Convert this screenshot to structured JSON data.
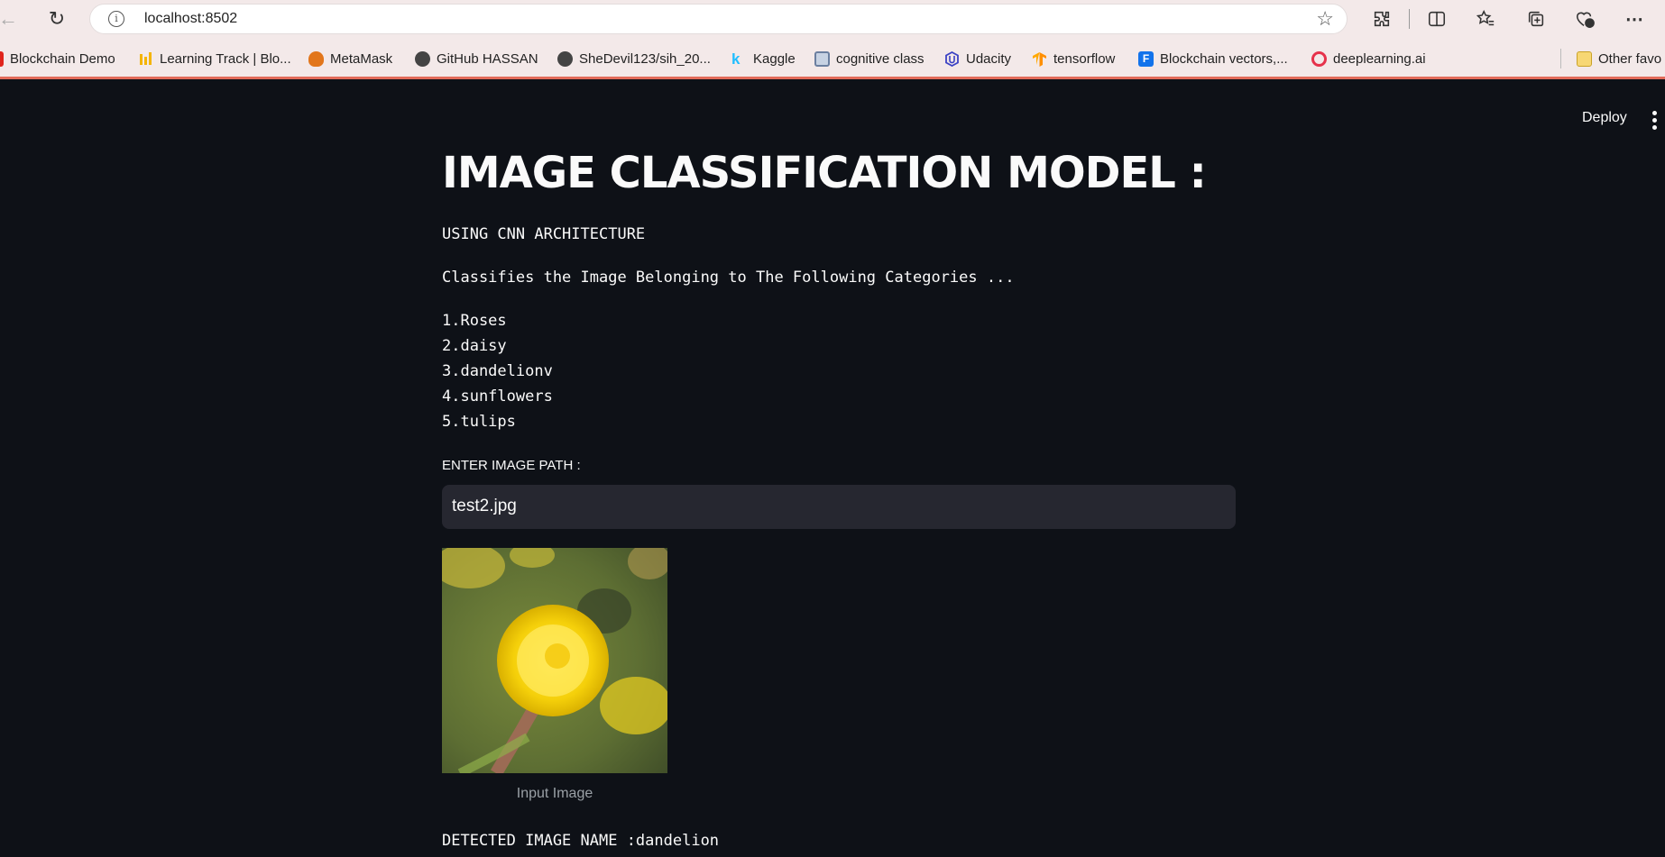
{
  "browser": {
    "url": "localhost:8502",
    "bookmarks": [
      {
        "label": "Blockchain Demo",
        "icon": "adobe-icon",
        "color": "#e0241c"
      },
      {
        "label": "Learning Track | Blo...",
        "icon": "bars-icon",
        "color": "#f4b400"
      },
      {
        "label": "MetaMask",
        "icon": "fox-icon",
        "color": "#e2761b"
      },
      {
        "label": "GitHub HASSAN",
        "icon": "github-icon",
        "color": "#444444"
      },
      {
        "label": "SheDevil123/sih_20...",
        "icon": "github-icon",
        "color": "#444444"
      },
      {
        "label": "Kaggle",
        "icon": "kaggle-icon",
        "color": "#20beff"
      },
      {
        "label": "cognitive class",
        "icon": "cognitive-class-icon",
        "color": "#6b7fa0"
      },
      {
        "label": "Udacity",
        "icon": "udacity-icon",
        "color": "#3b42c4"
      },
      {
        "label": "tensorflow",
        "icon": "tensorflow-icon",
        "color": "#ff8f00"
      },
      {
        "label": "Blockchain vectors,...",
        "icon": "freepik-icon",
        "color": "#1273eb"
      },
      {
        "label": "deeplearning.ai",
        "icon": "deeplearning-icon",
        "color": "#e6324b"
      }
    ],
    "other_favorites": "Other favo"
  },
  "app": {
    "deploy_label": "Deploy",
    "title": "IMAGE CLASSIFICATION MODEL :",
    "subtitle": "USING CNN ARCHITECTURE",
    "description": "Classifies the Image Belonging to The Following Categories ...",
    "categories": [
      "1.Roses",
      "2.daisy",
      "3.dandelionv",
      "4.sunflowers",
      "5.tulips"
    ],
    "input_label": "ENTER IMAGE PATH :",
    "input_value": "test2.jpg",
    "image_caption": "Input Image",
    "result": "DETECTED IMAGE NAME :dandelion"
  }
}
